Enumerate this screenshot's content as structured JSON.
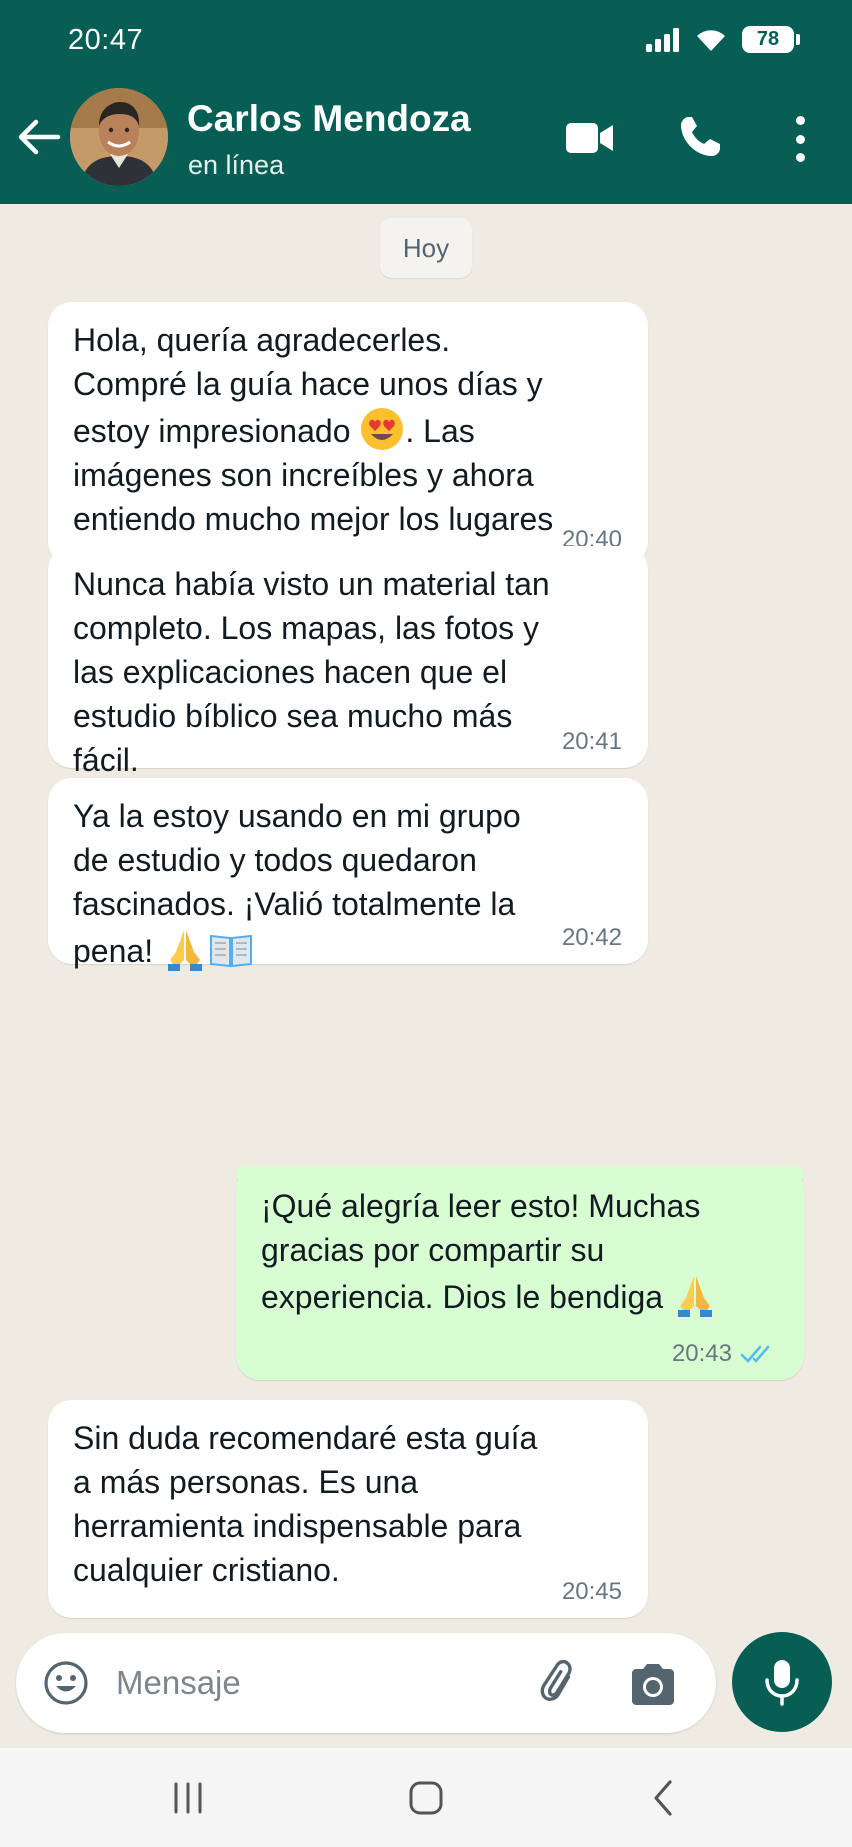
{
  "status_bar": {
    "time": "20:47",
    "battery": "78",
    "icons": [
      "signal-icon",
      "wifi-icon",
      "battery-icon"
    ]
  },
  "contact": {
    "name": "Carlos Mendoza",
    "status": "en línea"
  },
  "header_icons": [
    "back-arrow-icon",
    "video-call-icon",
    "voice-call-icon",
    "more-options-icon"
  ],
  "date_label": "Hoy",
  "messages": [
    {
      "direction": "in",
      "time": "20:40",
      "text_before_emoji": "Hola, quería agradecerles.\nCompré la guía hace unos días y\nestoy impresionado ",
      "emoji": "heart-eyes-emoji",
      "text_after_emoji": ". Las\nimágenes son increíbles y ahora\nentiendo mucho mejor los lugares\nmencionados en la Biblia."
    },
    {
      "direction": "in",
      "time": "20:41",
      "text": "Nunca había visto un material tan\ncompleto. Los mapas, las fotos y\nlas explicaciones hacen que el\nestudio bíblico sea mucho más\nfácil."
    },
    {
      "direction": "in",
      "time": "20:42",
      "text": "Ya la estoy usando en mi grupo\nde estudio y todos quedaron\nfascinados. ¡Valió totalmente la\npena! ",
      "emojis": [
        "praying-hands-emoji",
        "open-book-emoji"
      ]
    },
    {
      "direction": "out",
      "time": "20:43",
      "text": "¡Qué alegría leer esto! Muchas\ngracias por compartir su\nexperiencia. Dios le bendiga ",
      "emoji": "praying-hands-emoji",
      "read_status": "read"
    },
    {
      "direction": "in",
      "time": "20:45",
      "text": "Sin duda recomendaré esta guía\na más personas. Es una\nherramienta indispensable para\ncualquier cristiano."
    }
  ],
  "composer": {
    "placeholder": "Mensaje",
    "icons": [
      "emoji-icon",
      "attach-icon",
      "camera-icon",
      "mic-icon"
    ]
  },
  "nav_bar": {
    "icons": [
      "recents-icon",
      "home-icon",
      "back-icon"
    ]
  },
  "colors": {
    "header": "#075e54",
    "chat_background": "#efeae2",
    "incoming_bubble": "#ffffff",
    "outgoing_bubble": "#d9fdd3",
    "read_ticks": "#53bdeb"
  }
}
